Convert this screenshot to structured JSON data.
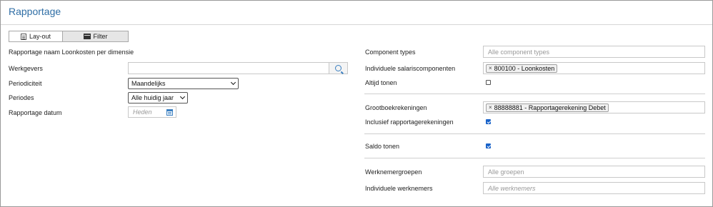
{
  "page": {
    "title": "Rapportage"
  },
  "tabs": [
    {
      "label": "Lay-out",
      "icon": "layout-icon",
      "active": true
    },
    {
      "label": "Filter",
      "icon": "filter-icon",
      "active": false
    }
  ],
  "left": {
    "report_name": "Rapportage naam Loonkosten per dimensie",
    "werkgevers": {
      "label": "Werkgevers",
      "value": ""
    },
    "periodiciteit": {
      "label": "Periodiciteit",
      "selected": "Maandelijks"
    },
    "periodes": {
      "label": "Periodes",
      "selected": "Alle huidig jaar"
    },
    "rapportage_datum": {
      "label": "Rapportage datum",
      "placeholder": "Heden"
    }
  },
  "right": {
    "component_types": {
      "label": "Component types",
      "placeholder": "Alle component types"
    },
    "salariscomponenten": {
      "label": "Individuele salariscomponenten",
      "tag": "800100 - Loonkosten"
    },
    "altijd_tonen": {
      "label": "Altijd tonen",
      "checked": false
    },
    "grootboekrekeningen": {
      "label": "Grootboekrekeningen",
      "tag": "88888881 - Rapportagerekening Debet"
    },
    "inclusief": {
      "label": "Inclusief rapportagerekeningen",
      "checked": true
    },
    "saldo_tonen": {
      "label": "Saldo tonen",
      "checked": true
    },
    "werknemergroepen": {
      "label": "Werknemergroepen",
      "placeholder": "Alle groepen"
    },
    "werknemers": {
      "label": "Individuele werknemers",
      "placeholder": "Alle werknemers"
    }
  },
  "colors": {
    "title": "#2f6ea5",
    "accent": "#1a63c9"
  }
}
